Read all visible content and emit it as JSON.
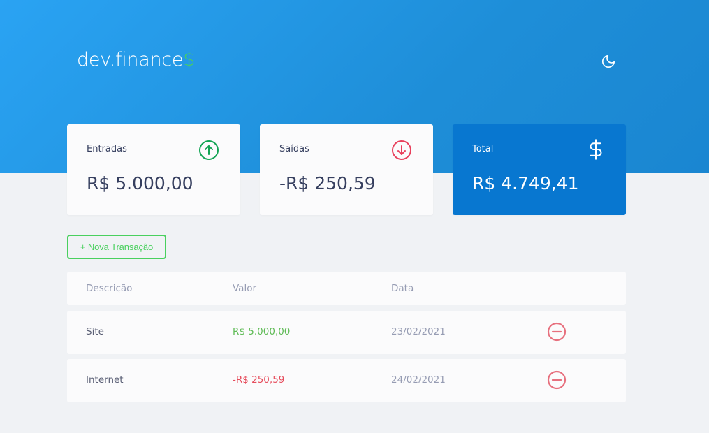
{
  "header": {
    "logo_text": "dev.finance",
    "logo_symbol": "$",
    "theme_icon": "moon-icon"
  },
  "cards": {
    "income": {
      "label": "Entradas",
      "value": "R$ 5.000,00",
      "icon": "arrow-up-circle-icon",
      "icon_color": "#12a454"
    },
    "expense": {
      "label": "Saídas",
      "value": "-R$ 250,59",
      "icon": "arrow-down-circle-icon",
      "icon_color": "#e83f5b"
    },
    "total": {
      "label": "Total",
      "value": "R$ 4.749,41",
      "icon": "dollar-sign-icon",
      "background": "#0877d0"
    }
  },
  "new_transaction_label": "+ Nova Transação",
  "table": {
    "headers": [
      "Descrição",
      "Valor",
      "Data"
    ],
    "rows": [
      {
        "description": "Site",
        "amount": "R$ 5.000,00",
        "date": "23/02/2021",
        "type": "income"
      },
      {
        "description": "Internet",
        "amount": "-R$ 250,59",
        "date": "24/02/2021",
        "type": "expense"
      }
    ]
  },
  "colors": {
    "accent_green": "#49d05e",
    "header_blue": "#2aa3f3",
    "income_green": "#5fbb56",
    "expense_red": "#e64c5c",
    "remove_red": "#e7707e"
  }
}
